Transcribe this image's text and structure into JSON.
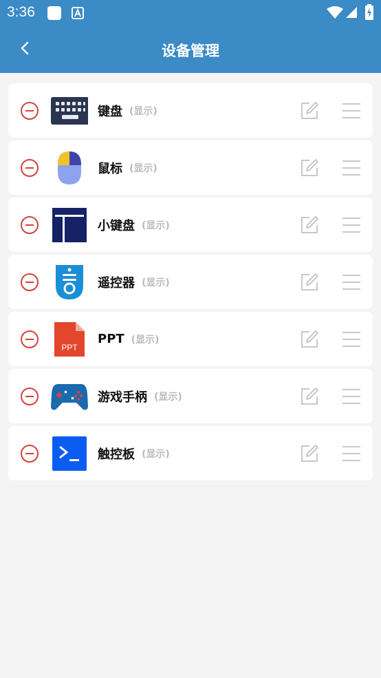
{
  "status_bar": {
    "time": "3:36",
    "icons": [
      "square-notification-icon",
      "a-notification-icon",
      "wifi-icon",
      "signal-icon",
      "battery-charging-icon"
    ]
  },
  "header": {
    "title": "设备管理",
    "back_icon": "back-arrow-icon",
    "background": "#3a8bc6"
  },
  "devices": [
    {
      "name": "键盘",
      "status": "(显示)",
      "icon": "keyboard-icon"
    },
    {
      "name": "鼠标",
      "status": "(显示)",
      "icon": "mouse-icon"
    },
    {
      "name": "小键盘",
      "status": "(显示)",
      "icon": "numpad-icon"
    },
    {
      "name": "遥控器",
      "status": "(显示)",
      "icon": "remote-control-icon"
    },
    {
      "name": "PPT",
      "status": "(显示)",
      "icon": "ppt-icon"
    },
    {
      "name": "游戏手柄",
      "status": "(显示)",
      "icon": "gamepad-icon"
    },
    {
      "name": "触控板",
      "status": "(显示)",
      "icon": "terminal-touchpad-icon"
    }
  ],
  "colors": {
    "remove": "#d0433a",
    "status_text": "#bbbbbb",
    "background": "#f4f4f4"
  }
}
